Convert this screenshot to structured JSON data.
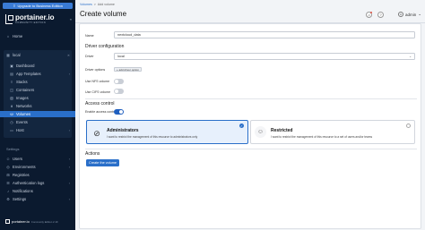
{
  "sidebar": {
    "upgrade_label": "Upgrade to Business Edition",
    "logo_name": "portainer.io",
    "logo_sub": "COMMUNITY EDITION",
    "home_label": "Home",
    "environment": "local",
    "env_items": [
      {
        "label": "Dashboard",
        "icon": "dashboard-icon"
      },
      {
        "label": "App Templates",
        "icon": "templates-icon"
      },
      {
        "label": "Stacks",
        "icon": "stacks-icon"
      },
      {
        "label": "Containers",
        "icon": "containers-icon"
      },
      {
        "label": "Images",
        "icon": "images-icon"
      },
      {
        "label": "Networks",
        "icon": "networks-icon"
      },
      {
        "label": "Volumes",
        "icon": "volumes-icon"
      },
      {
        "label": "Events",
        "icon": "events-icon"
      },
      {
        "label": "Host",
        "icon": "host-icon"
      }
    ],
    "settings_title": "Settings",
    "settings_items": [
      {
        "label": "Users",
        "icon": "users-icon"
      },
      {
        "label": "Environments",
        "icon": "environments-icon"
      },
      {
        "label": "Registries",
        "icon": "registries-icon"
      },
      {
        "label": "Authentication logs",
        "icon": "logs-icon"
      },
      {
        "label": "Notifications",
        "icon": "bell-icon"
      },
      {
        "label": "Settings",
        "icon": "gear-icon"
      }
    ],
    "footer_name": "portainer.io",
    "footer_version": "Community Edition 2.19"
  },
  "header": {
    "breadcrumb_link": "Volumes",
    "breadcrumb_sep": ">",
    "breadcrumb_current": "Add volume",
    "title": "Create volume",
    "user": "admin"
  },
  "form": {
    "name_label": "Name",
    "name_value": "nextcloud_data",
    "driver_heading": "Driver configuration",
    "driver_label": "Driver",
    "driver_value": "local",
    "driver_options_label": "Driver options",
    "add_option_label": "+ add driver option",
    "nfs_label": "Use NFS volume",
    "cifs_label": "Use CIFS volume",
    "access_heading": "Access control",
    "access_toggle_label": "Enable access control",
    "admin_title": "Administrators",
    "admin_desc": "I want to restrict the management of this resource to administrators only",
    "restricted_title": "Restricted",
    "restricted_desc": "I want to restrict the management of this resource to a set of users and/or teams",
    "actions_heading": "Actions",
    "create_label": "Create the volume"
  },
  "colors": {
    "accent": "#2a6fc9",
    "sidebar_bg": "#0b1a2f"
  }
}
